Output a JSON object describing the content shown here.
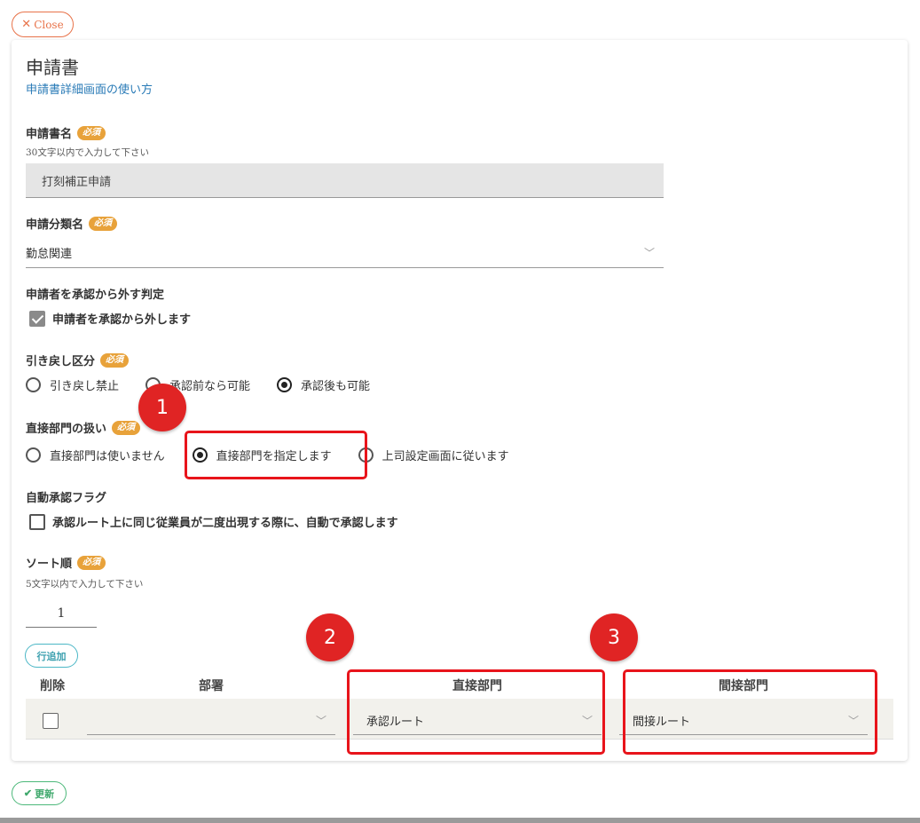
{
  "close_button": {
    "icon": "close-icon",
    "icon_glyph": "✕",
    "label": "Close"
  },
  "form": {
    "title": "申請書",
    "help_link": "申請書詳細画面の使い方",
    "required_badge": "必須",
    "name_field": {
      "label": "申請書名",
      "hint": "30文字以内で入力して下さい",
      "value": "打刻補正申請"
    },
    "category_field": {
      "label": "申請分類名",
      "value": "勤怠関連"
    },
    "exclude_applicant": {
      "label": "申請者を承認から外す判定",
      "checkbox_label": "申請者を承認から外します",
      "checked": true
    },
    "withdrawal": {
      "label": "引き戻し区分",
      "options": [
        "引き戻し禁止",
        "承認前なら可能",
        "承認後も可能"
      ],
      "selected": 2
    },
    "direct_dept": {
      "label": "直接部門の扱い",
      "options": [
        "直接部門は使いません",
        "直接部門を指定します",
        "上司設定画面に従います"
      ],
      "selected": 1
    },
    "auto_approve": {
      "label": "自動承認フラグ",
      "checkbox_label": "承認ルート上に同じ従業員が二度出現する際に、自動で承認します",
      "checked": false
    },
    "sort_order": {
      "label": "ソート順",
      "hint": "5文字以内で入力して下さい",
      "value": "1"
    }
  },
  "table": {
    "add_row_button": "行追加",
    "headers": [
      "削除",
      "部署",
      "直接部門",
      "間接部門"
    ],
    "row": {
      "department": "",
      "direct": "承認ルート",
      "indirect": "間接ルート"
    }
  },
  "annotations": [
    "1",
    "2",
    "3"
  ],
  "update_button": {
    "icon": "check-icon",
    "icon_glyph": "✔",
    "label": "更新"
  },
  "colors": {
    "accent_orange": "#e8734a",
    "badge": "#e8a23a",
    "link": "#2a7bb7",
    "highlight_red": "#e8141b",
    "marker_red": "#e02424",
    "teal": "#4bb7c6",
    "green": "#4cb87a"
  }
}
